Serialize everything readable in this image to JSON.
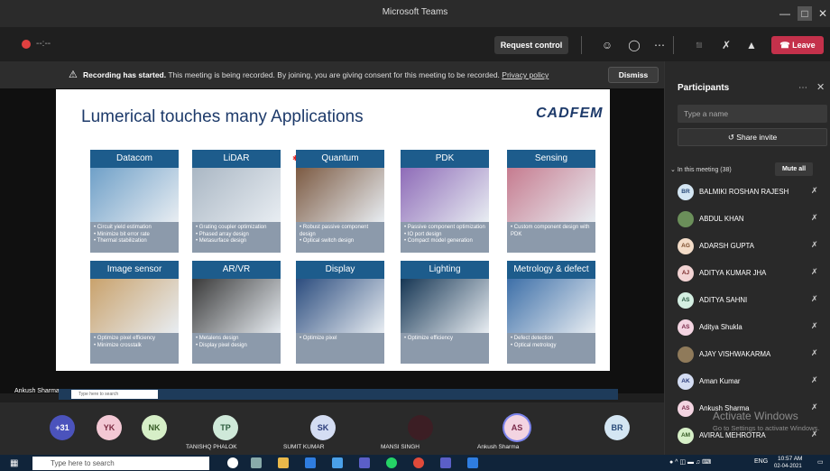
{
  "window": {
    "title": "Microsoft Teams"
  },
  "toolbar": {
    "timer": "--:--",
    "request_control": "Request control",
    "leave": "Leave"
  },
  "banner": {
    "bold": "Recording has started.",
    "text": " This meeting is being recorded. By joining, you are giving consent for this meeting to be recorded. ",
    "link": "Privacy policy",
    "dismiss": "Dismiss"
  },
  "slide": {
    "title": "Lumerical touches many Applications",
    "logo": "CADFEM",
    "cards": [
      {
        "title": "Datacom",
        "bullets": [
          "Circuit yield estimation",
          "Minimize bit error rate",
          "Thermal stabilization"
        ],
        "color": "#6fa0c8"
      },
      {
        "title": "LiDAR",
        "bullets": [
          "Grating coupler optimization",
          "Phased array design",
          "Metasurface design"
        ],
        "color": "#aab7c4"
      },
      {
        "title": "Quantum",
        "bullets": [
          "Robust passive component design",
          "Optical switch design"
        ],
        "color": "#7c5a42"
      },
      {
        "title": "PDK",
        "bullets": [
          "Passive component optimization",
          "IO port design",
          "Compact model generation"
        ],
        "color": "#8e6bb8"
      },
      {
        "title": "Sensing",
        "bullets": [
          "Custom component design with PDK"
        ],
        "color": "#c67b8f"
      },
      {
        "title": "Image sensor",
        "bullets": [
          "Optimize pixel efficiency",
          "Minimize crosstalk"
        ],
        "color": "#c9a26c"
      },
      {
        "title": "AR/VR",
        "bullets": [
          "Metalens design",
          "Display pixel design"
        ],
        "color": "#3a3a3a"
      },
      {
        "title": "Display",
        "bullets": [
          "Optimize pixel"
        ],
        "color": "#2b4c7e"
      },
      {
        "title": "Lighting",
        "bullets": [
          "Optimize efficiency"
        ],
        "color": "#163654"
      },
      {
        "title": "Metrology & defect",
        "bullets": [
          "Defect detection",
          "Optical metrology"
        ],
        "color": "#3d6fa8"
      }
    ]
  },
  "presenter": {
    "label": "Ankush Sharma",
    "inner_search": "Type here to search"
  },
  "participants_row": [
    {
      "initials": "+31",
      "name": "",
      "bg": "#4b53bc",
      "fg": "#fff"
    },
    {
      "initials": "YK",
      "name": "",
      "bg": "#f3c8d4",
      "fg": "#7a2a40"
    },
    {
      "initials": "NK",
      "name": "",
      "bg": "#d6efc7",
      "fg": "#355a24"
    },
    {
      "initials": "TP",
      "name": "TANISHQ PHALOK",
      "bg": "#cfe9d9",
      "fg": "#2b5a3c"
    },
    {
      "initials": "SK",
      "name": "SUMIT KUMAR",
      "bg": "#d4ddf3",
      "fg": "#2b3c7a"
    },
    {
      "initials": "",
      "name": "MANSI SINGH",
      "bg": "#3c1e24",
      "fg": "#fff"
    },
    {
      "initials": "AS",
      "name": "Ankush Sharma",
      "bg": "#f3d4e1",
      "fg": "#7a2a4a"
    },
    {
      "initials": "BR",
      "name": "",
      "bg": "#d4e6f3",
      "fg": "#2b4c7a"
    }
  ],
  "panel": {
    "title": "Participants",
    "search_placeholder": "Type a name",
    "share_invite": "Share invite",
    "in_meeting": "In this meeting (38)",
    "mute_all": "Mute all",
    "people": [
      {
        "initials": "BR",
        "name": "BALMIKI ROSHAN RAJESH",
        "bg": "#d4e6f3",
        "fg": "#2b4c7a"
      },
      {
        "initials": "",
        "name": "ABDUL KHAN",
        "bg": "#6b8f5a",
        "fg": "#fff"
      },
      {
        "initials": "AG",
        "name": "ADARSH GUPTA",
        "bg": "#f3dcc8",
        "fg": "#7a4a2a"
      },
      {
        "initials": "AJ",
        "name": "ADITYA KUMAR JHA",
        "bg": "#f3d4d4",
        "fg": "#7a2a2a"
      },
      {
        "initials": "AS",
        "name": "ADITYA SAHNI",
        "bg": "#d4efe2",
        "fg": "#2b5a44"
      },
      {
        "initials": "AS",
        "name": "Aditya Shukla",
        "bg": "#f3d4e1",
        "fg": "#7a2a4a"
      },
      {
        "initials": "",
        "name": "AJAY VISHWAKARMA",
        "bg": "#8f7a5a",
        "fg": "#fff"
      },
      {
        "initials": "AK",
        "name": "Aman Kumar",
        "bg": "#d4ddf3",
        "fg": "#2b3c7a"
      },
      {
        "initials": "AS",
        "name": "Ankush Sharma",
        "bg": "#f3d4e1",
        "fg": "#7a2a4a"
      },
      {
        "initials": "AM",
        "name": "AVIRAL MEHROTRA",
        "bg": "#d6efc7",
        "fg": "#355a24"
      }
    ]
  },
  "watermark": {
    "line1": "Activate Windows",
    "line2": "Go to Settings to activate Windows."
  },
  "taskbar": {
    "search_placeholder": "Type here to search",
    "lang": "ENG",
    "time": "10:57 AM",
    "date": "02-04-2021"
  }
}
